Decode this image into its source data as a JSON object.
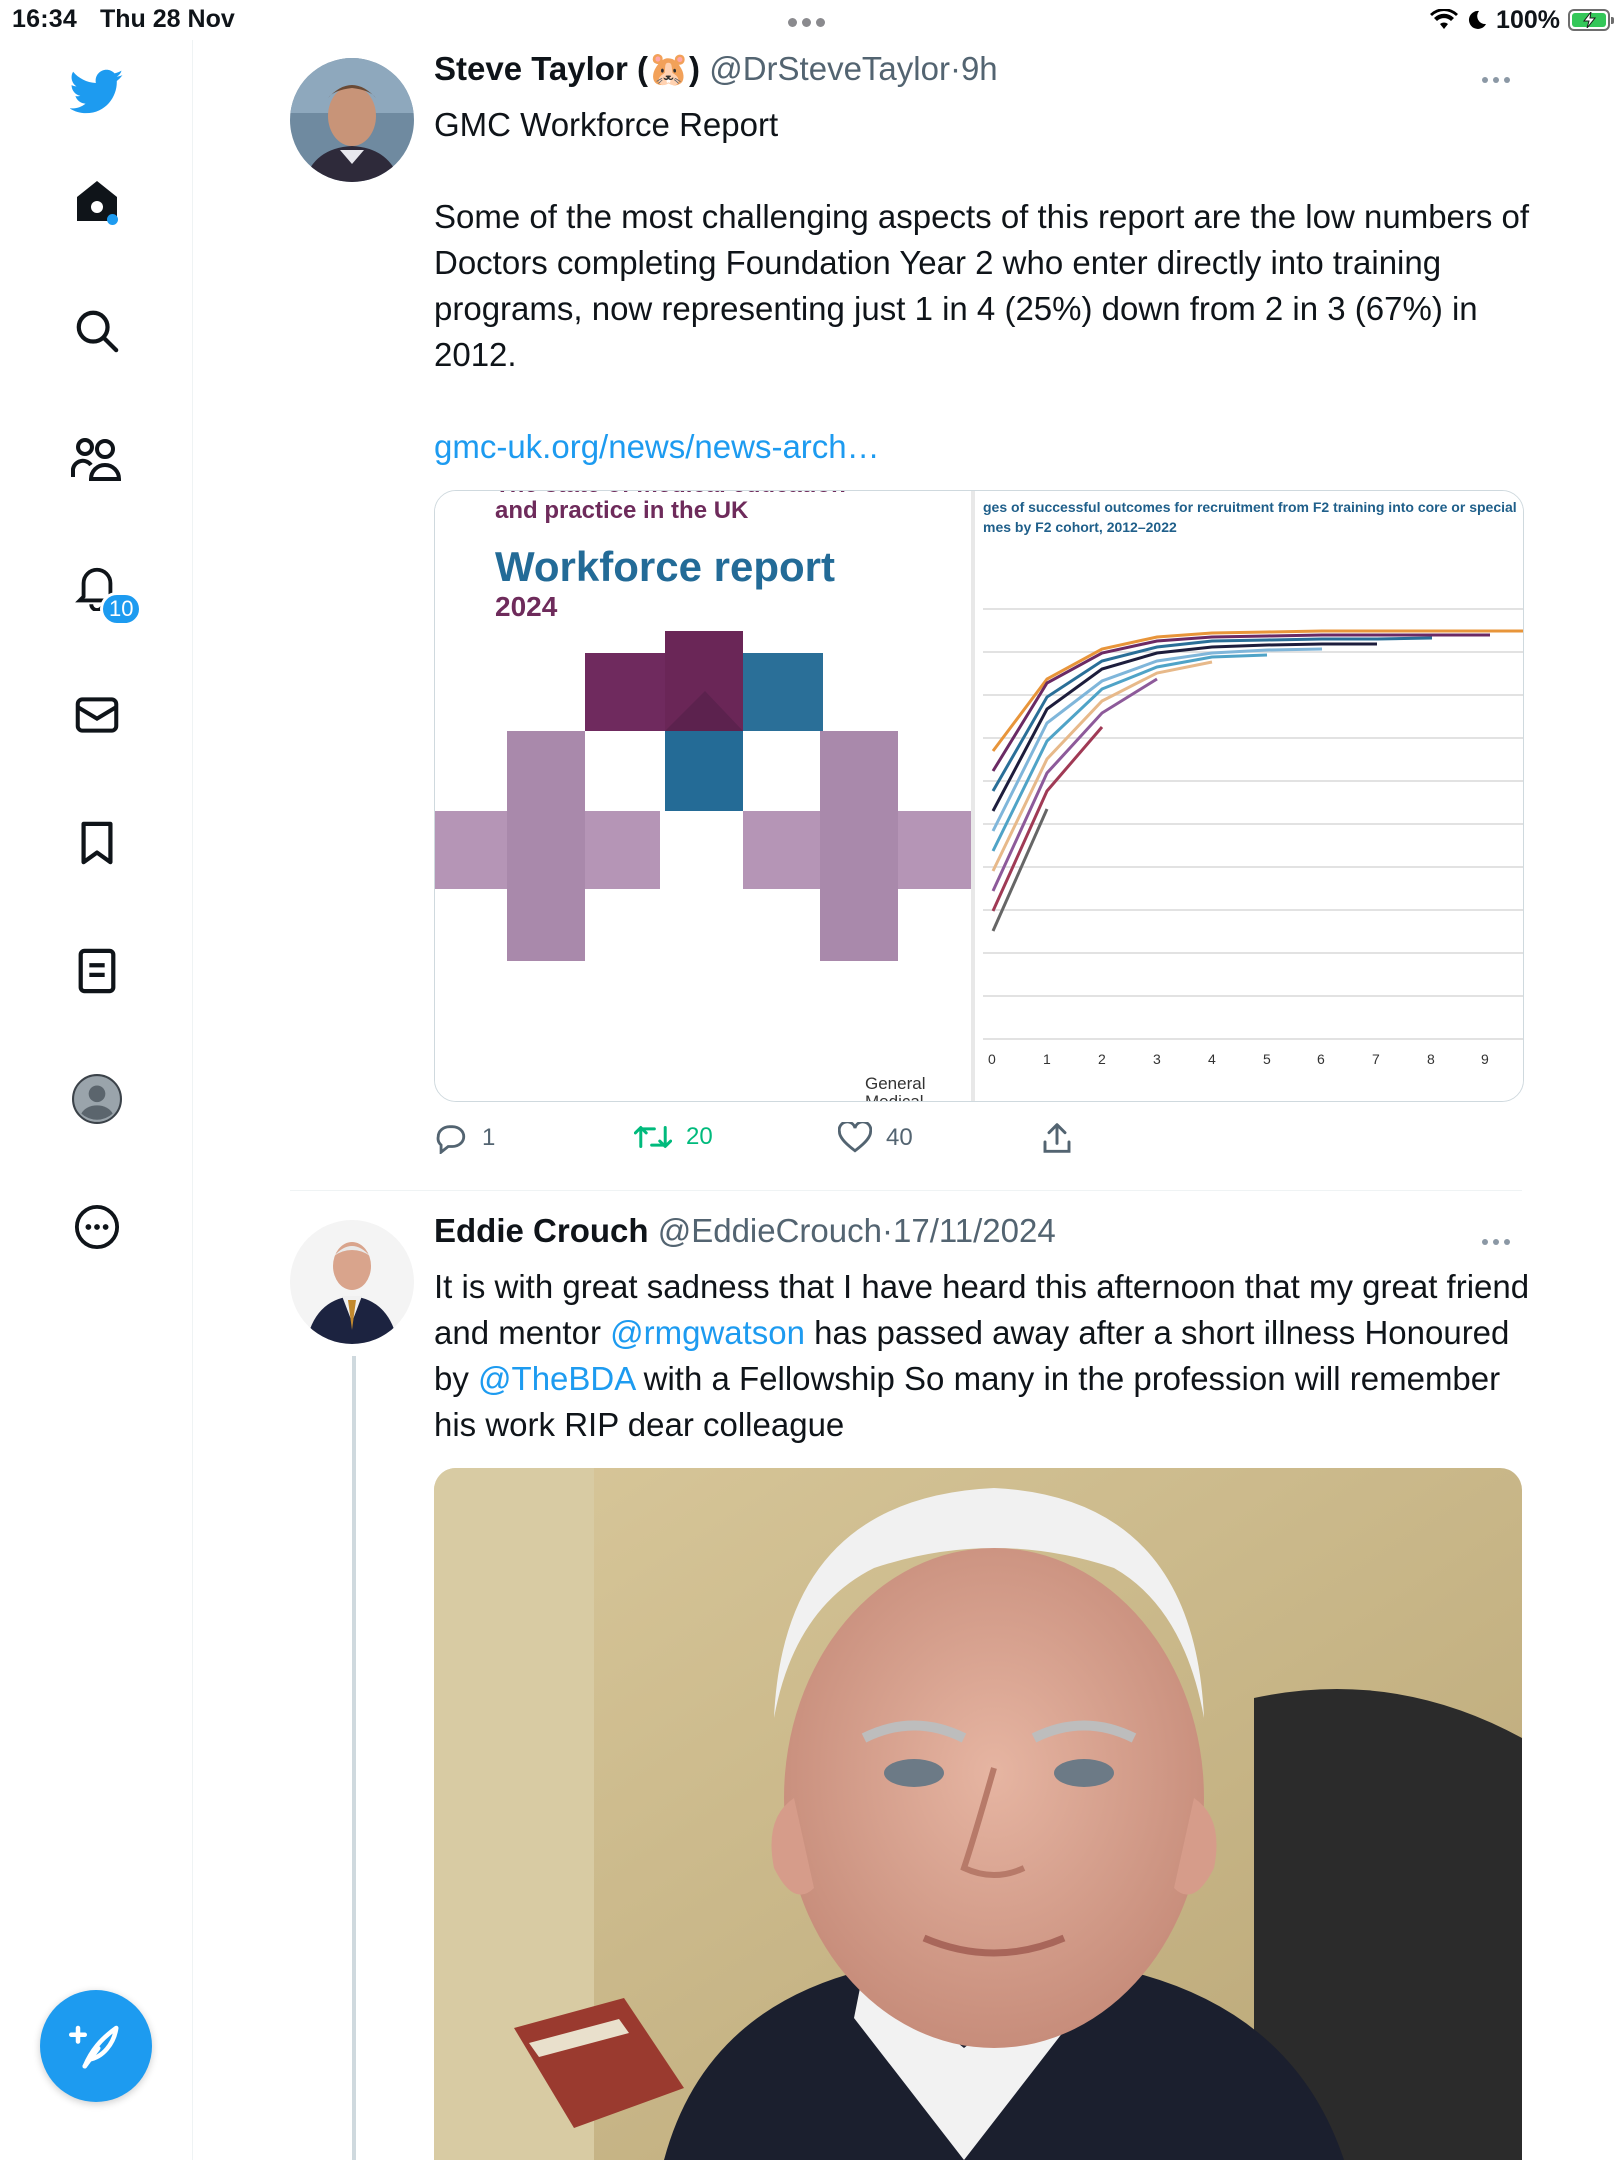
{
  "status_bar": {
    "time": "16:34",
    "date": "Thu 28 Nov",
    "battery": "100%"
  },
  "sidebar": {
    "items": [
      {
        "name": "home",
        "icon": "home-icon"
      },
      {
        "name": "explore",
        "icon": "search-icon"
      },
      {
        "name": "communities",
        "icon": "communities-icon"
      },
      {
        "name": "notifications",
        "icon": "bell-icon",
        "badge": "10"
      },
      {
        "name": "messages",
        "icon": "mail-icon"
      },
      {
        "name": "bookmarks",
        "icon": "bookmark-icon"
      },
      {
        "name": "lists",
        "icon": "list-icon"
      },
      {
        "name": "profile",
        "icon": "profile-icon"
      },
      {
        "name": "more",
        "icon": "more-circle-icon"
      }
    ],
    "accent": "#1d9bf0"
  },
  "tweets": [
    {
      "name": "Steve Taylor (🐹)",
      "handle": "@DrSteveTaylor",
      "dot": "·",
      "time": "9h",
      "text_line1": "GMC Workforce Report",
      "text_body": "Some of the most challenging aspects of this report are the low numbers of Doctors completing Foundation Year 2 who enter directly into training programs, now representing just 1 in 4 (25%) down from 2 in 3 (67%) in 2012.",
      "link": "gmc-uk.org/news/news-arch…",
      "media_left": {
        "subtitle_top": "The state of medical education",
        "subtitle": "and practice in the UK",
        "title": "Workforce report",
        "year": "2024",
        "publisher_1": "General",
        "publisher_2": "Medical"
      },
      "media_right": {
        "title_line1": "ges of successful outcomes for recruitment from F2 training into core or special",
        "title_line2": "mes by F2 cohort, 2012–2022",
        "x_ticks": [
          "0",
          "1",
          "2",
          "3",
          "4",
          "5",
          "6",
          "7",
          "8",
          "9"
        ]
      },
      "replies": "1",
      "retweets": "20",
      "likes": "40"
    },
    {
      "name": "Eddie Crouch",
      "handle": "@EddieCrouch",
      "dot": "·",
      "time": "17/11/2024",
      "text_a": "It is with great sadness that I have heard this afternoon that my great friend and mentor ",
      "mention_1": "@rmgwatson",
      "text_b": " has passed away after a short illness Honoured by ",
      "mention_2": "@TheBDA",
      "text_c": " with a Fellowship So many in the profession will remember his work RIP dear colleague"
    }
  ]
}
